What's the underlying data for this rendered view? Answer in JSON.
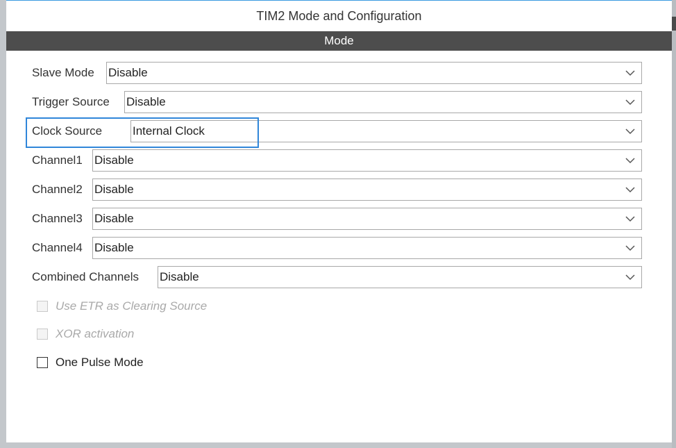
{
  "window": {
    "title": "TIM2 Mode and Configuration"
  },
  "section": {
    "header": "Mode"
  },
  "fields": [
    {
      "label": "Slave Mode",
      "value": "Disable"
    },
    {
      "label": "Trigger Source",
      "value": "Disable"
    },
    {
      "label": "Clock Source",
      "value": "Internal Clock"
    },
    {
      "label": "Channel1",
      "value": "Disable"
    },
    {
      "label": "Channel2",
      "value": "Disable"
    },
    {
      "label": "Channel3",
      "value": "Disable"
    },
    {
      "label": "Channel4",
      "value": "Disable"
    },
    {
      "label": "Combined Channels",
      "value": "Disable"
    }
  ],
  "checkboxes": [
    {
      "label": "Use ETR as Clearing Source",
      "enabled": false,
      "checked": false
    },
    {
      "label": "XOR activation",
      "enabled": false,
      "checked": false
    },
    {
      "label": "One Pulse Mode",
      "enabled": true,
      "checked": false
    }
  ],
  "colors": {
    "section_header_bg": "#4d4d4d",
    "highlight": "#2f86d9",
    "background": "#c3c7cb"
  },
  "icons": {
    "dropdown": "chevron-down-icon"
  }
}
